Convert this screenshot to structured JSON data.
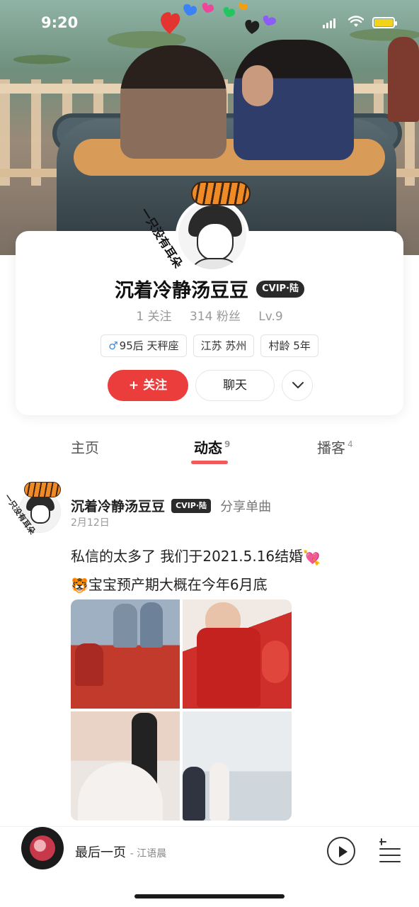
{
  "status_bar": {
    "time": "9:20"
  },
  "profile": {
    "avatar_caption": "一只没有耳朵",
    "name": "沉着冷静汤豆豆",
    "vip_badge": "CVIP·陆",
    "stats": {
      "following": "1 关注",
      "fans": "314 粉丝",
      "level": "Lv.9"
    },
    "tags": [
      "95后 天秤座",
      "江苏 苏州",
      "村龄 5年"
    ],
    "gender_symbol": "♂",
    "follow_label": "+ 关注",
    "chat_label": "聊天"
  },
  "tabs": [
    {
      "label": "主页",
      "count": ""
    },
    {
      "label": "动态",
      "count": "9"
    },
    {
      "label": "播客",
      "count": "4"
    }
  ],
  "post": {
    "avatar_caption": "一只没有耳朵",
    "author": "沉着冷静汤豆豆",
    "vip_badge": "CVIP·陆",
    "action": "分享单曲",
    "date": "2月12日",
    "line1": "私信的太多了 我们于2021.5.16结婚",
    "line1_emoji": "💘",
    "line2_emoji": "🐯",
    "line2": "宝宝预产期大概在今年6月底"
  },
  "player": {
    "song": "最后一页",
    "artist": "- 江语晨"
  },
  "colors": {
    "accent_red": "#ec3d3d",
    "vip_badge_bg": "#2b2b2b",
    "male_blue": "#3b8bd9"
  },
  "icons": [
    "signal-icon",
    "wifi-icon",
    "battery-icon",
    "chevron-down-icon",
    "play-icon",
    "playlist-icon"
  ]
}
